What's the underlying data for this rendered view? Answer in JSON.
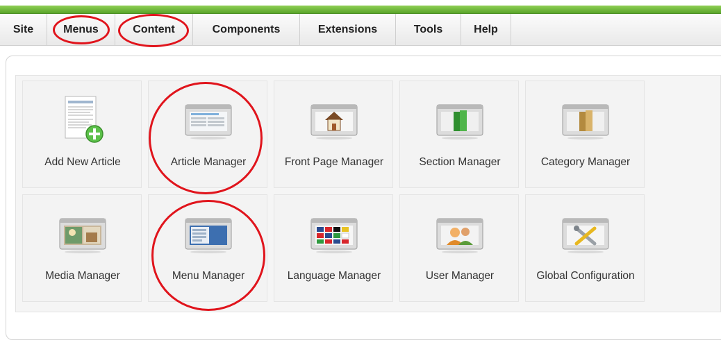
{
  "menubar": {
    "items": [
      {
        "label": "Site"
      },
      {
        "label": "Menus"
      },
      {
        "label": "Content"
      },
      {
        "label": "Components"
      },
      {
        "label": "Extensions"
      },
      {
        "label": "Tools"
      },
      {
        "label": "Help"
      }
    ]
  },
  "control_panel": {
    "tiles": [
      {
        "label": "Add New Article",
        "icon": "add-article-icon"
      },
      {
        "label": "Article Manager",
        "icon": "article-manager-icon"
      },
      {
        "label": "Front Page Manager",
        "icon": "home-icon"
      },
      {
        "label": "Section Manager",
        "icon": "section-icon"
      },
      {
        "label": "Category Manager",
        "icon": "category-icon"
      },
      {
        "label": "Media Manager",
        "icon": "media-icon"
      },
      {
        "label": "Menu Manager",
        "icon": "menu-icon"
      },
      {
        "label": "Language Manager",
        "icon": "language-flags-icon"
      },
      {
        "label": "User Manager",
        "icon": "users-icon"
      },
      {
        "label": "Global Configuration",
        "icon": "tools-icon"
      }
    ]
  },
  "colors": {
    "topbar_green": "#5aa52a",
    "annotation_red": "#e0141c"
  }
}
